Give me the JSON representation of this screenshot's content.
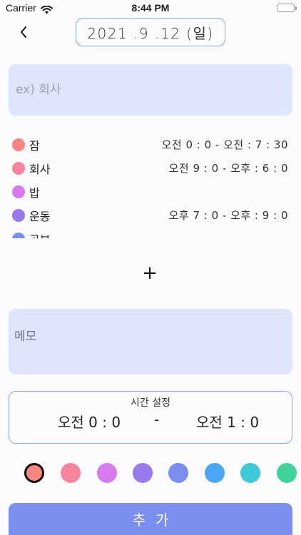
{
  "status_bar": {
    "carrier": "Carrier",
    "time": "8:44 PM"
  },
  "header": {
    "date": "2021 .9 .12 (일)"
  },
  "title_input": {
    "placeholder": "ex) 회사"
  },
  "schedule": [
    {
      "label": "잠",
      "time": "오전 0 : 0 - 오전 : 7 : 30",
      "color": "#f8857f"
    },
    {
      "label": "회사",
      "time": "오전 9 : 0 - 오후 : 6 : 0",
      "color": "#f6849f"
    },
    {
      "label": "밥",
      "time": "",
      "color": "#d879ee"
    },
    {
      "label": "운동",
      "time": "오후 7 : 0 - 오후 : 9 : 0",
      "color": "#9a78ee"
    },
    {
      "label": "공부",
      "time": "",
      "color": "#7a8ef0"
    }
  ],
  "add_label": "+",
  "memo": {
    "placeholder": "메모"
  },
  "time_setting": {
    "title": "시간 설정",
    "start": "오전 0 : 0",
    "dash": "-",
    "end": "오전 1 : 0"
  },
  "palette": [
    {
      "color": "#f8857f",
      "selected": true
    },
    {
      "color": "#f6849f",
      "selected": false
    },
    {
      "color": "#d879ee",
      "selected": false
    },
    {
      "color": "#9a78ee",
      "selected": false
    },
    {
      "color": "#7a8ef0",
      "selected": false
    },
    {
      "color": "#4aa6f2",
      "selected": false
    },
    {
      "color": "#3ec8d8",
      "selected": false
    },
    {
      "color": "#3fd29a",
      "selected": false
    }
  ],
  "submit_label": "추가"
}
